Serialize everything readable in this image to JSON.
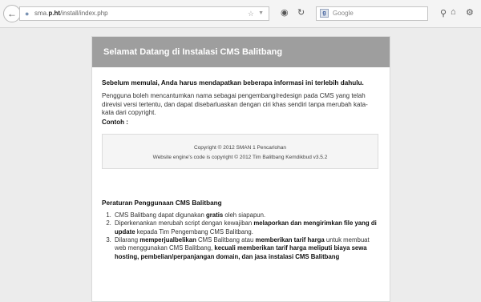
{
  "browser": {
    "url_prefix": "sma.",
    "url_domain": "p.ht",
    "url_path": "/install/index.php",
    "search_placeholder": "Google"
  },
  "panel": {
    "title": "Selamat Datang di Instalasi CMS Balitbang",
    "intro": "Sebelum memulai, Anda harus mendapatkan beberapa informasi ini terlebih dahulu.",
    "paragraph": "Pengguna boleh mencantumkan nama sebagai pengembang/redesign pada CMS yang telah direvisi versi tertentu, dan dapat disebarluaskan dengan ciri khas sendiri tanpa merubah kata-kata dari copyright.",
    "contoh_label": "Contoh :",
    "copyright_line1": "Copyright © 2012 SMAN 1 Pencarlohan",
    "copyright_line2": "Website engine's code is copyright © 2012 Tim Balitbang Kemdikbud v3.5.2",
    "rules_title": "Peraturan Penggunaan CMS Balitbang",
    "rules": {
      "r1_a": "CMS Balitbang dapat digunakan ",
      "r1_b": "gratis",
      "r1_c": " oleh siapapun.",
      "r2_a": "Diperkenankan merubah script dengan kewajiban ",
      "r2_b": "melaporkan dan mengirimkan file yang di update",
      "r2_c": " kepada Tim Pengembang CMS Balitbang.",
      "r3_a": "Dilarang ",
      "r3_b": "memperjualbelikan",
      "r3_c": " CMS Balitbang atau ",
      "r3_d": "memberikan tarif harga",
      "r3_e": " untuk membuat web menggunakan CMS Balitbang, ",
      "r3_f": "kecuali memberikan tarif harga meliputi biaya sewa hosting, pembelian/perpanjangan domain, dan jasa instalasi CMS Balitbang"
    }
  }
}
